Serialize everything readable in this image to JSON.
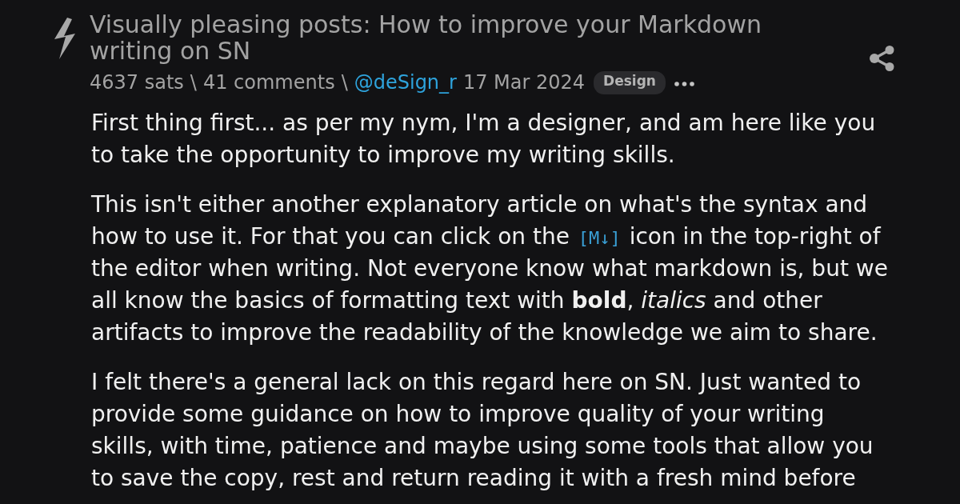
{
  "post": {
    "title": "Visually pleasing posts: How to improve your Markdown writing on SN",
    "meta": [
      {
        "kind": "sats",
        "text": "4637 sats"
      },
      {
        "kind": "separator",
        "text": "\\"
      },
      {
        "kind": "comments",
        "text": "41 comments"
      },
      {
        "kind": "separator",
        "text": "\\"
      },
      {
        "kind": "author",
        "text": "@deSign_r"
      },
      {
        "kind": "date",
        "text": "17 Mar 2024"
      }
    ],
    "tag": "Design",
    "body": [
      {
        "segments": [
          {
            "kind": "text",
            "text": "First thing first... as per my nym, I'm a designer, and am here like you to take the opportunity to improve my writing skills."
          }
        ]
      },
      {
        "segments": [
          {
            "kind": "text",
            "text": "This isn't either another explanatory article on what's the syntax and how to use it. For that you can click on the "
          },
          {
            "kind": "code",
            "text": "[M↓]"
          },
          {
            "kind": "text",
            "text": " icon in the top-right of the editor when writing. Not everyone know what markdown is, but we all know the basics of formatting text with **bold**, *italics* and other artifacts to improve the readability of the knowledge we aim to share."
          }
        ]
      },
      {
        "segments": [
          {
            "kind": "text",
            "text": "I felt there's a general lack on this regard here on SN. Just wanted to provide some guidance on how to improve quality of your writing skills, with time, patience and maybe using some tools that allow you to save the copy, rest and return reading it with a fresh mind before"
          }
        ]
      }
    ]
  }
}
